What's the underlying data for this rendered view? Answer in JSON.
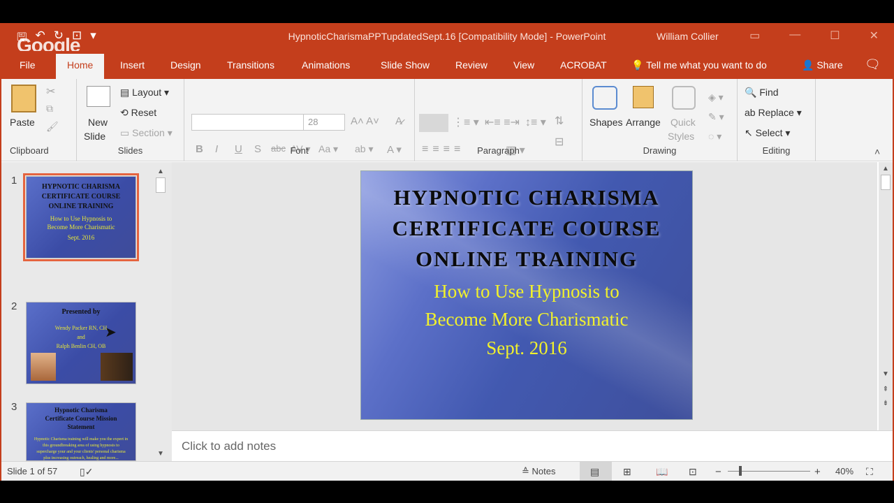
{
  "window": {
    "title": "HypnoticCharismaPPTupdatedSept.16 [Compatibility Mode] - PowerPoint",
    "user": "William Collier",
    "overlay_logo": "Google"
  },
  "tabs": [
    {
      "label": "File"
    },
    {
      "label": "Home",
      "active": true
    },
    {
      "label": "Insert"
    },
    {
      "label": "Design"
    },
    {
      "label": "Transitions"
    },
    {
      "label": "Animations"
    },
    {
      "label": "Slide Show"
    },
    {
      "label": "Review"
    },
    {
      "label": "View"
    },
    {
      "label": "ACROBAT"
    }
  ],
  "tell_me": "Tell me what you want to do",
  "share": "Share",
  "ribbon": {
    "clipboard": {
      "paste": "Paste",
      "label": "Clipboard"
    },
    "slides": {
      "new_slide": "New",
      "new_slide2": "Slide",
      "layout": "Layout",
      "reset": "Reset",
      "section": "Section",
      "label": "Slides"
    },
    "font": {
      "font_size": "28",
      "label": "Font"
    },
    "paragraph": {
      "label": "Paragraph"
    },
    "drawing": {
      "shapes": "Shapes",
      "arrange": "Arrange",
      "quick": "Quick",
      "styles": "Styles",
      "label": "Drawing"
    },
    "editing": {
      "find": "Find",
      "replace": "Replace",
      "select": "Select",
      "label": "Editing"
    }
  },
  "thumbnails": [
    {
      "num": "1",
      "title": "HYPNOTIC CHARISMA CERTIFICATE COURSE ONLINE TRAINING",
      "sub": "How to Use Hypnosis to Become More Charismatic",
      "date": "Sept. 2016"
    },
    {
      "num": "2",
      "title": "Presented by",
      "line1": "Wendy Packer RN, CH",
      "line2": "and",
      "line3": "Ralph Benlin CH, OB"
    },
    {
      "num": "3",
      "title": "Hypnotic Charisma Certificate Course Mission Statement",
      "body": "Hypnotic Charisma training will make you the expert in this groundbreaking area of using hypnosis to supercharge your and your clients' personal charisma plus increasing outreach, healing and more..."
    }
  ],
  "slide": {
    "title_line1": "HYPNOTIC CHARISMA",
    "title_line2": "CERTIFICATE COURSE",
    "title_line3": "ONLINE TRAINING",
    "sub_line1": "How to Use Hypnosis to",
    "sub_line2": "Become More Charismatic",
    "date": "Sept. 2016"
  },
  "notes_placeholder": "Click to add notes",
  "status": {
    "slide_counter": "Slide 1 of 57",
    "notes_btn": "Notes",
    "zoom": "40%"
  },
  "colors": {
    "accent": "#c43e1c",
    "slide_yellow": "#f1f12c"
  }
}
